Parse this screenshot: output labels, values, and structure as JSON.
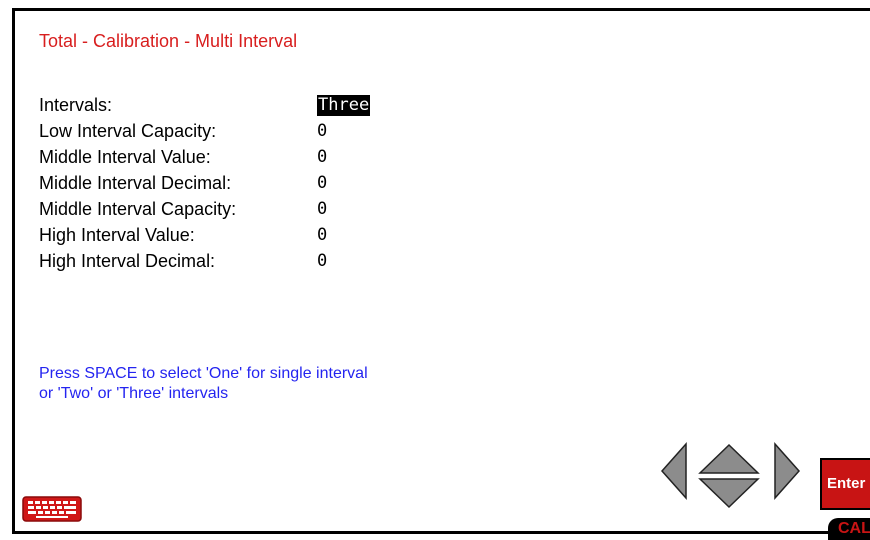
{
  "title": "Total - Calibration - Multi Interval",
  "fields": [
    {
      "label": "Intervals:",
      "value": "Three",
      "selected": true
    },
    {
      "label": "Low Interval Capacity:",
      "value": "0"
    },
    {
      "label": "Middle Interval Value:",
      "value": "0"
    },
    {
      "label": "Middle Interval Decimal:",
      "value": "0"
    },
    {
      "label": "Middle Interval Capacity:",
      "value": "0"
    },
    {
      "label": "High Interval Value:",
      "value": "0"
    },
    {
      "label": "High Interval Decimal:",
      "value": "0"
    }
  ],
  "help_text": "Press SPACE to select 'One' for single interval or 'Two' or 'Three' intervals",
  "buttons": {
    "enter_label": "Enter",
    "cal_label": "CAL"
  },
  "icons": {
    "keyboard": "keyboard-icon",
    "left": "arrow-left-icon",
    "up": "arrow-up-icon",
    "down": "arrow-down-icon",
    "right": "arrow-right-icon"
  },
  "colors": {
    "title": "#d81e1e",
    "help": "#2424f0",
    "enter_bg": "#c81414",
    "keyboard": "#d01818",
    "arrows": "#8c8c8c"
  }
}
